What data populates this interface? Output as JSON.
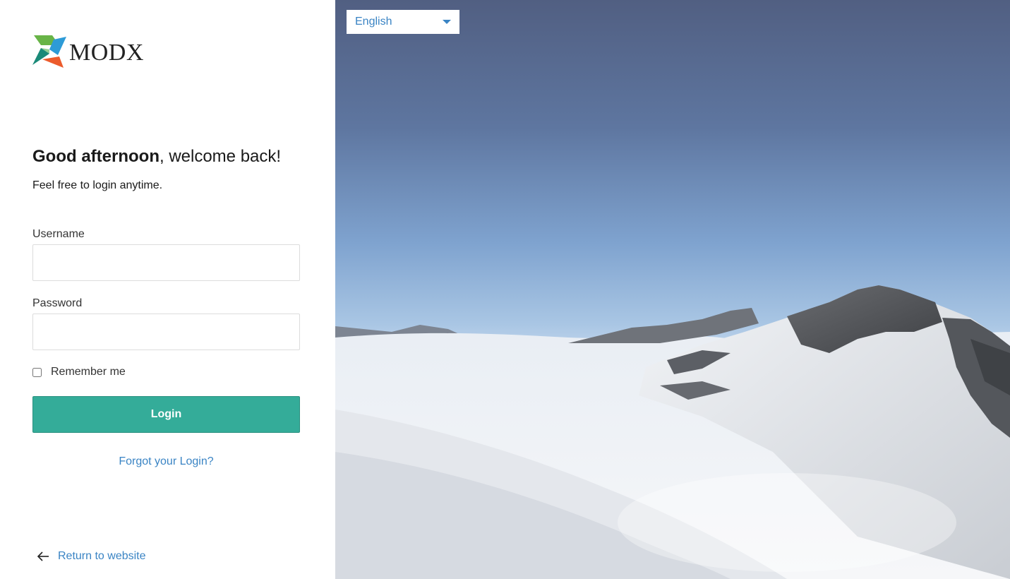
{
  "brand": {
    "name": "MODX",
    "logo_colors": [
      "#68b447",
      "#2d9bd7",
      "#ec5b2c",
      "#1a8a78"
    ]
  },
  "greeting": {
    "strong": "Good afternoon",
    "rest": ", welcome back!",
    "subtitle": "Feel free to login anytime."
  },
  "form": {
    "username_label": "Username",
    "username_value": "",
    "password_label": "Password",
    "password_value": "",
    "remember_label": "Remember me",
    "remember_checked": false,
    "login_label": "Login",
    "forgot_label": "Forgot your Login?"
  },
  "footer": {
    "return_label": "Return to website"
  },
  "language": {
    "selected": "English"
  },
  "colors": {
    "accent": "#34ac99",
    "link": "#3a84c4",
    "text": "#1a1a1a"
  }
}
